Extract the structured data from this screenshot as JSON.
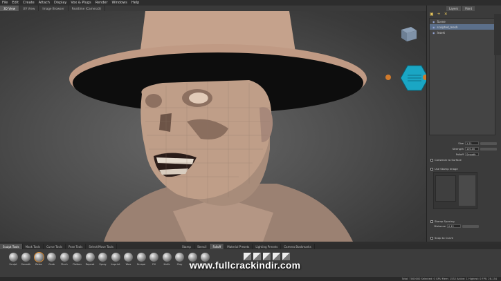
{
  "menu": [
    "File",
    "Edit",
    "Create",
    "Attach",
    "Display",
    "Vox & Plugs",
    "Render",
    "Windows",
    "Help"
  ],
  "view_tabs": [
    {
      "label": "3D View",
      "active": true
    },
    {
      "label": "UV View",
      "active": false
    },
    {
      "label": "Image Browser",
      "active": false
    },
    {
      "label": "Realtime (Camera3)",
      "active": false
    }
  ],
  "watermark": "www.fullcrackindir.com",
  "status_text": "Total: 7000000  Selected: 0  GPU Mem: 1532  Active: 1  Highest: 0  FPS: 28.134",
  "right_panel": {
    "tabs": [
      "Layers",
      "Paint"
    ],
    "tree": [
      {
        "label": "Scene",
        "selected": false
      },
      {
        "label": "sculpted_mesh",
        "selected": true
      },
      {
        "label": "Insert",
        "selected": false
      }
    ],
    "props": [
      {
        "label": "Size",
        "value": "1.21"
      },
      {
        "label": "Strength",
        "value": "100.00"
      },
      {
        "label": "Falloff",
        "value": "Smooth"
      }
    ],
    "checks": [
      {
        "label": "Constrain to Surface"
      },
      {
        "label": "Use Stamp Image"
      },
      {
        "label": "Stamp Spacing"
      }
    ],
    "spacing_label": "Distance",
    "spacing_value": "0.12",
    "bottom_check": "Snap to Curve",
    "colors": {
      "accent": "#e38c2b",
      "hex": "#1aa6c4",
      "selection": "#5b6f8a"
    }
  },
  "bottom_tabs_left": [
    {
      "label": "Sculpt Tools",
      "active": true
    },
    {
      "label": "Mask Tools",
      "active": false
    },
    {
      "label": "Curve Tools",
      "active": false
    },
    {
      "label": "Pose Tools",
      "active": false
    },
    {
      "label": "Select/Move Tools",
      "active": false
    }
  ],
  "bottom_tabs_right": [
    {
      "label": "Stamp",
      "active": false
    },
    {
      "label": "Stencil",
      "active": false
    },
    {
      "label": "Falloff",
      "active": true
    },
    {
      "label": "Material Presets",
      "active": false
    },
    {
      "label": "Lighting Presets",
      "active": false
    },
    {
      "label": "Camera Bookmarks",
      "active": false
    }
  ],
  "tools": [
    "Sculpt",
    "Smooth",
    "Relax",
    "Grab",
    "Pinch",
    "Flatten",
    "Repeat",
    "Spray",
    "Imprint",
    "Wax",
    "Scrape",
    "Fill",
    "Knife",
    "Clay",
    "Bulge",
    "Mask"
  ]
}
